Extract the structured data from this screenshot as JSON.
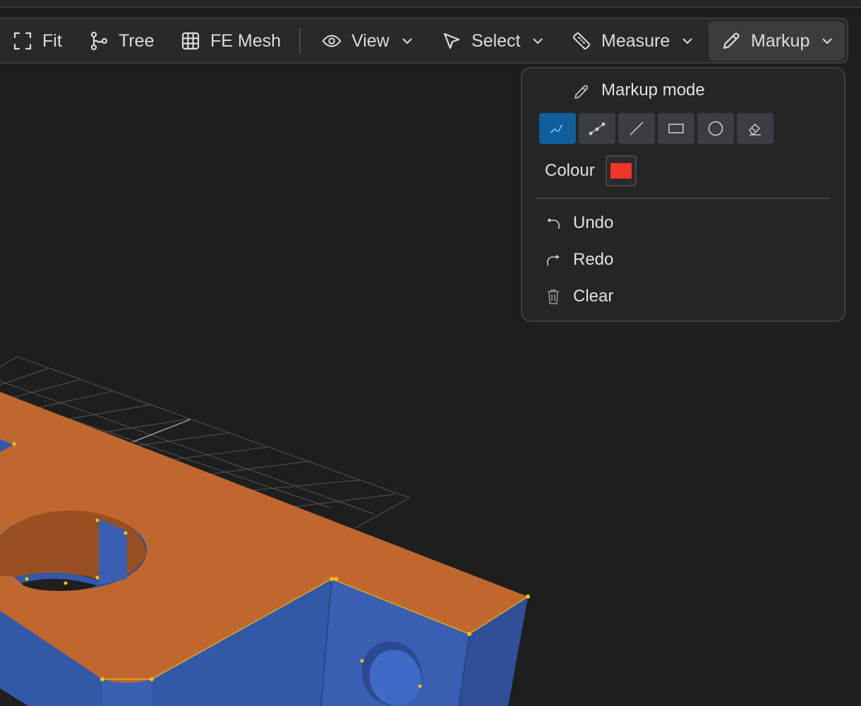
{
  "toolbar": {
    "fit": "Fit",
    "tree": "Tree",
    "fe_mesh": "FE Mesh",
    "view": "View",
    "select": "Select",
    "measure": "Measure",
    "markup": "Markup"
  },
  "markup_menu": {
    "title": "Markup mode",
    "tools": [
      "freehand-tool",
      "polyline-tool",
      "line-tool",
      "rectangle-tool",
      "circle-tool",
      "eraser-tool"
    ],
    "selected_tool": "freehand-tool",
    "colour_label": "Colour",
    "colour_value": "#f0352a",
    "undo": "Undo",
    "redo": "Redo",
    "clear": "Clear"
  },
  "colors": {
    "background": "#1e1e1e",
    "accent_selected": "#0e5f9c",
    "model_top_face": "#c0672f",
    "model_side_face": "#3458a8",
    "edge_vertex": "#f2c20c"
  }
}
